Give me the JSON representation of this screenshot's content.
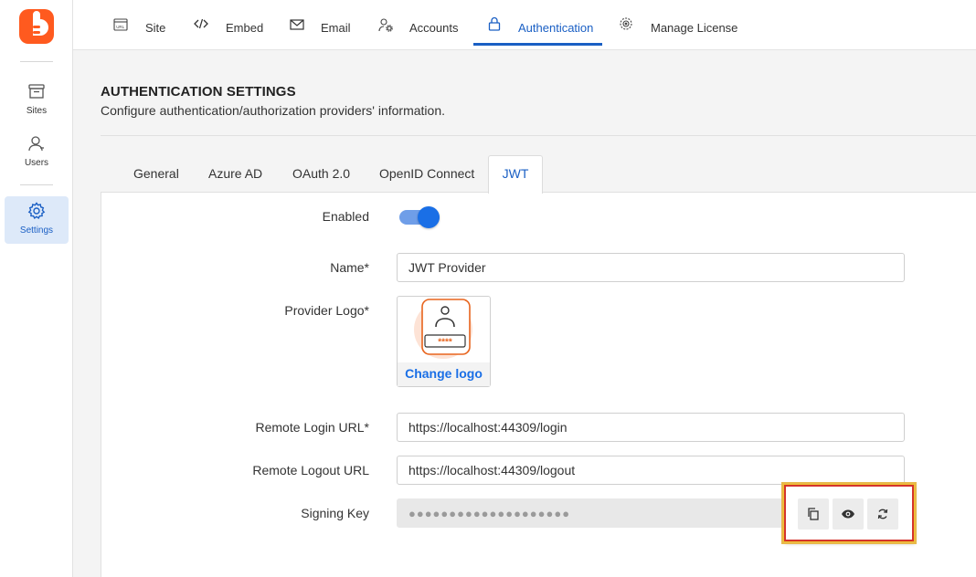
{
  "rail": {
    "items": [
      {
        "label": "Sites",
        "icon": "archive-icon"
      },
      {
        "label": "Users",
        "icon": "user-icon"
      },
      {
        "label": "Settings",
        "icon": "gear-icon",
        "active": true
      }
    ]
  },
  "topnav": {
    "tabs": [
      {
        "label": "Site",
        "icon": "url-icon"
      },
      {
        "label": "Embed",
        "icon": "code-icon"
      },
      {
        "label": "Email",
        "icon": "envelope-icon"
      },
      {
        "label": "Accounts",
        "icon": "user-gear-icon"
      },
      {
        "label": "Authentication",
        "icon": "lock-icon",
        "active": true
      },
      {
        "label": "Manage License",
        "icon": "license-gear-icon"
      }
    ]
  },
  "page": {
    "title": "AUTHENTICATION SETTINGS",
    "subtitle": "Configure authentication/authorization providers' information."
  },
  "tabs": [
    {
      "label": "General"
    },
    {
      "label": "Azure AD"
    },
    {
      "label": "OAuth 2.0"
    },
    {
      "label": "OpenID Connect"
    },
    {
      "label": "JWT",
      "active": true
    }
  ],
  "form": {
    "enabled_label": "Enabled",
    "enabled": true,
    "name_label": "Name*",
    "name_value": "JWT Provider",
    "logo_label": "Provider Logo*",
    "logo_password_text": "****",
    "change_logo_label": "Change logo",
    "login_url_label": "Remote Login URL*",
    "login_url_value": "https://localhost:44309/login",
    "logout_url_label": "Remote Logout URL",
    "logout_url_value": "https://localhost:44309/logout",
    "signing_key_label": "Signing Key",
    "signing_key_value": "●●●●●●●●●●●●●●●●●●●●",
    "signing_key_actions": [
      {
        "icon": "copy-icon"
      },
      {
        "icon": "eye-icon"
      },
      {
        "icon": "refresh-icon"
      }
    ]
  },
  "colors": {
    "brand": "#ff5a1f",
    "accent": "#1a5fc4",
    "toggle_on": "#1a6fe6",
    "highlight_border": "#d4342c"
  }
}
